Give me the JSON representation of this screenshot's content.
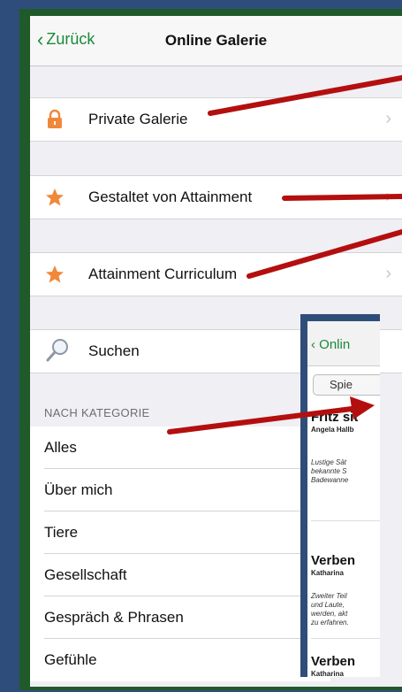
{
  "navbar": {
    "back_label": "Zurück",
    "title": "Online Galerie"
  },
  "rows": [
    {
      "label": "Private Galerie",
      "icon": "lock-icon",
      "chevron": "›"
    },
    {
      "label": "Gestaltet von Attainment",
      "icon": "star-icon",
      "chevron": "›"
    },
    {
      "label": "Attainment Curriculum",
      "icon": "star-icon",
      "chevron": "›"
    },
    {
      "label": "Suchen",
      "icon": "magnifier-icon"
    }
  ],
  "section_header": "NACH KATEGORIE",
  "categories": [
    "Alles",
    "Über mich",
    "Tiere",
    "Gesellschaft",
    "Gespräch & Phrasen",
    "Gefühle"
  ],
  "inset": {
    "back_label": "Onlin",
    "search_text": "Spie",
    "items": [
      {
        "title": "Fritz sit",
        "author": "Angela Hallb",
        "desc": [
          "Lustige Sät",
          "bekannte S",
          "Badewanne"
        ]
      },
      {
        "title": "Verben",
        "author": "Katharina",
        "desc": [
          "Zweiter Teil",
          "und Laute,",
          "werden, akt",
          "zu erfahren."
        ]
      },
      {
        "title": "Verben",
        "author": "Katharina",
        "desc": []
      }
    ]
  },
  "colors": {
    "accent": "#1a8a3a",
    "arrow": "#b40f0f",
    "lock": "#f0883a",
    "star": "#f0883a"
  }
}
